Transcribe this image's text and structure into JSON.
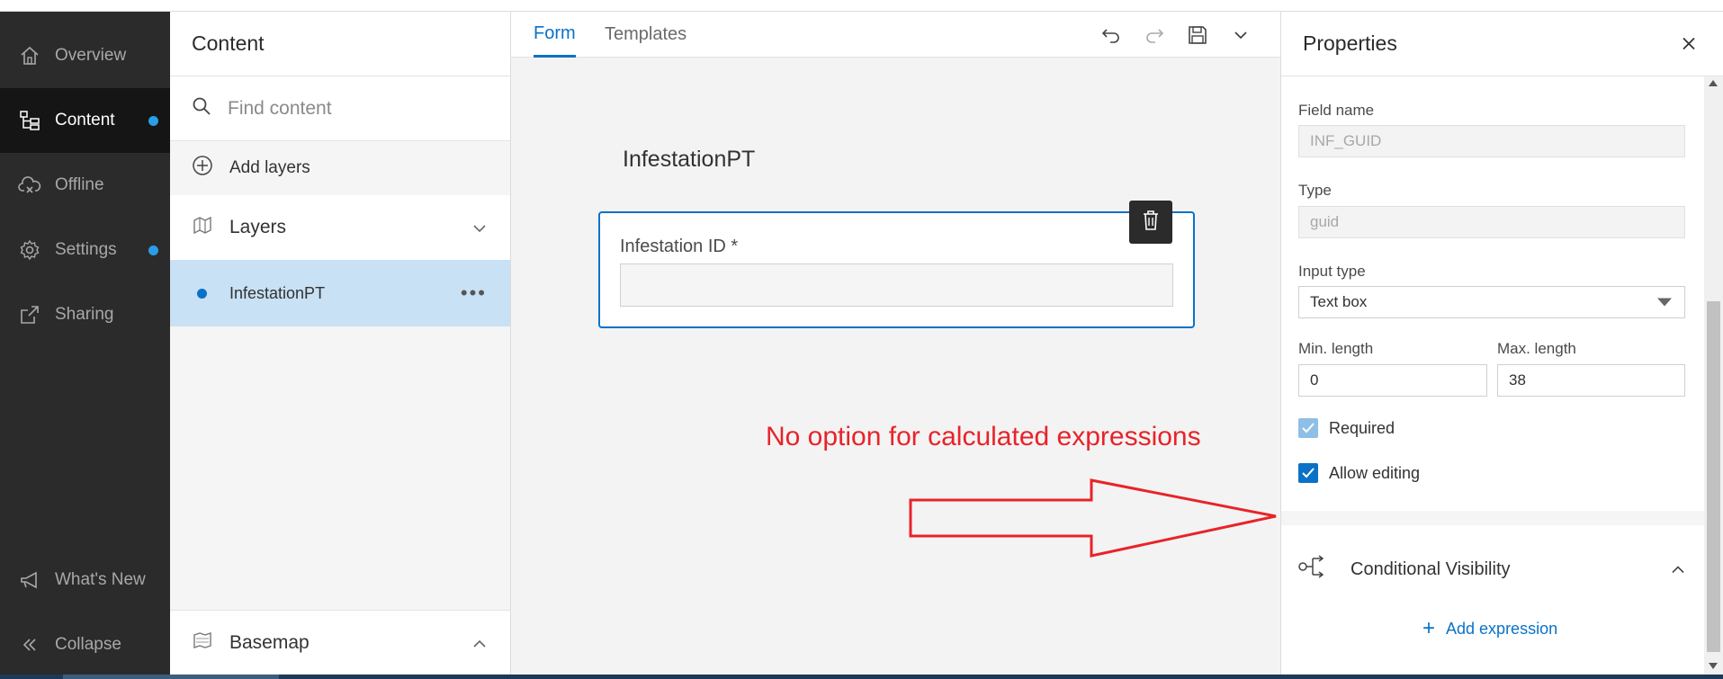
{
  "nav": {
    "items": [
      {
        "label": "Overview",
        "icon": "home-icon"
      },
      {
        "label": "Content",
        "icon": "content-tree-icon",
        "active": true,
        "badge": true
      },
      {
        "label": "Offline",
        "icon": "cloud-offline-icon"
      },
      {
        "label": "Settings",
        "icon": "gear-icon",
        "badge": true
      },
      {
        "label": "Sharing",
        "icon": "share-icon"
      }
    ],
    "whats_new": "What's New",
    "collapse": "Collapse"
  },
  "content_panel": {
    "title": "Content",
    "search_placeholder": "Find content",
    "add_layers": "Add layers",
    "layers_label": "Layers",
    "layer_items": [
      {
        "name": "InfestationPT"
      }
    ],
    "basemap_label": "Basemap"
  },
  "canvas": {
    "tabs": [
      {
        "label": "Form",
        "active": true
      },
      {
        "label": "Templates"
      }
    ],
    "form_title": "InfestationPT",
    "field": {
      "label": "Infestation ID *",
      "value": ""
    }
  },
  "annotation": {
    "text": "No option for calculated expressions",
    "color": "#e8232a"
  },
  "properties": {
    "title": "Properties",
    "field_name_label": "Field name",
    "field_name_value": "INF_GUID",
    "type_label": "Type",
    "type_value": "guid",
    "input_type_label": "Input type",
    "input_type_value": "Text box",
    "min_length_label": "Min. length",
    "min_length_value": "0",
    "max_length_label": "Max. length",
    "max_length_value": "38",
    "required_label": "Required",
    "required_checked": true,
    "allow_editing_label": "Allow editing",
    "allow_editing_checked": true,
    "conditional_visibility_label": "Conditional Visibility",
    "add_expression_label": "Add expression"
  },
  "colors": {
    "accent": "#0a72c6",
    "nav_bg": "#2b2b2b",
    "nav_active_bg": "#151515",
    "badge": "#2a9ee6",
    "selected_row": "#c8e1f4"
  }
}
